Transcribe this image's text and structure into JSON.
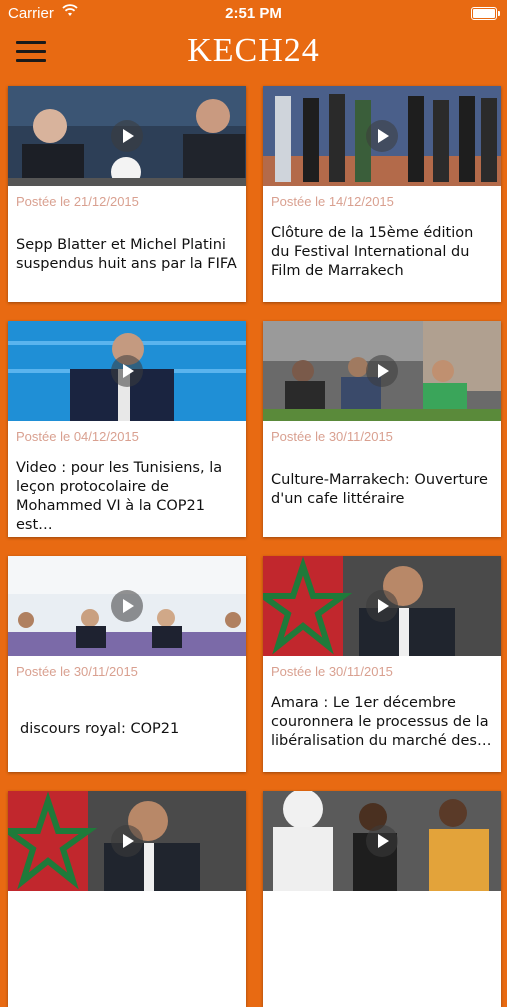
{
  "status": {
    "carrier": "Carrier",
    "time": "2:51 PM"
  },
  "header": {
    "logo": "KECH24"
  },
  "articles": [
    {
      "date": "Postée le 21/12/2015",
      "title": "Sepp Blatter et Michel Platini suspendus huit ans par la FIFA"
    },
    {
      "date": "Postée le 14/12/2015",
      "title": "Clôture de la 15ème édition du Festival International du Film de Marrakech"
    },
    {
      "date": "Postée le 04/12/2015",
      "title": "Video : pour les Tunisiens, la leçon protocolaire de Mohammed VI à la COP21 est…"
    },
    {
      "date": "Postée le 30/11/2015",
      "title": "Culture-Marrakech: Ouverture d'un cafe littéraire"
    },
    {
      "date": "Postée le 30/11/2015",
      "title": "discours royal: COP21"
    },
    {
      "date": "Postée le 30/11/2015",
      "title": "Amara : Le 1er décembre couronnera le processus de la libéralisation du marché des…"
    }
  ],
  "colors": {
    "background": "#e86a12",
    "date_text": "#d9a090"
  }
}
